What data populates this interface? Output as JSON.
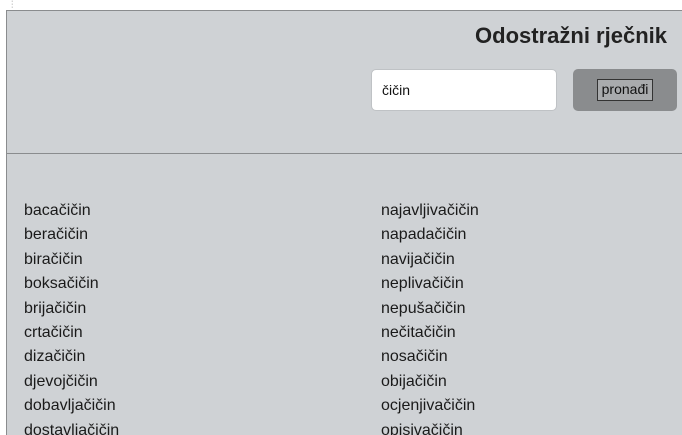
{
  "header": {
    "title": "Odostražni rječnik",
    "search_value": "čičin",
    "search_button_label": "pronađi"
  },
  "results": {
    "left_column": [
      "bacačičin",
      "beračičin",
      "biračičin",
      "boksačičin",
      "brijačičin",
      "crtačičin",
      "dizačičin",
      "djevojčičin",
      "dobavljačičin",
      "dostavljačičin"
    ],
    "right_column": [
      "najavljivačičin",
      "napadačičin",
      "navijačičin",
      "neplivačičin",
      "nepušačičin",
      "nečitačičin",
      "nosačičin",
      "obijačičin",
      "ocjenjivačičin",
      "opisivačičin"
    ]
  }
}
